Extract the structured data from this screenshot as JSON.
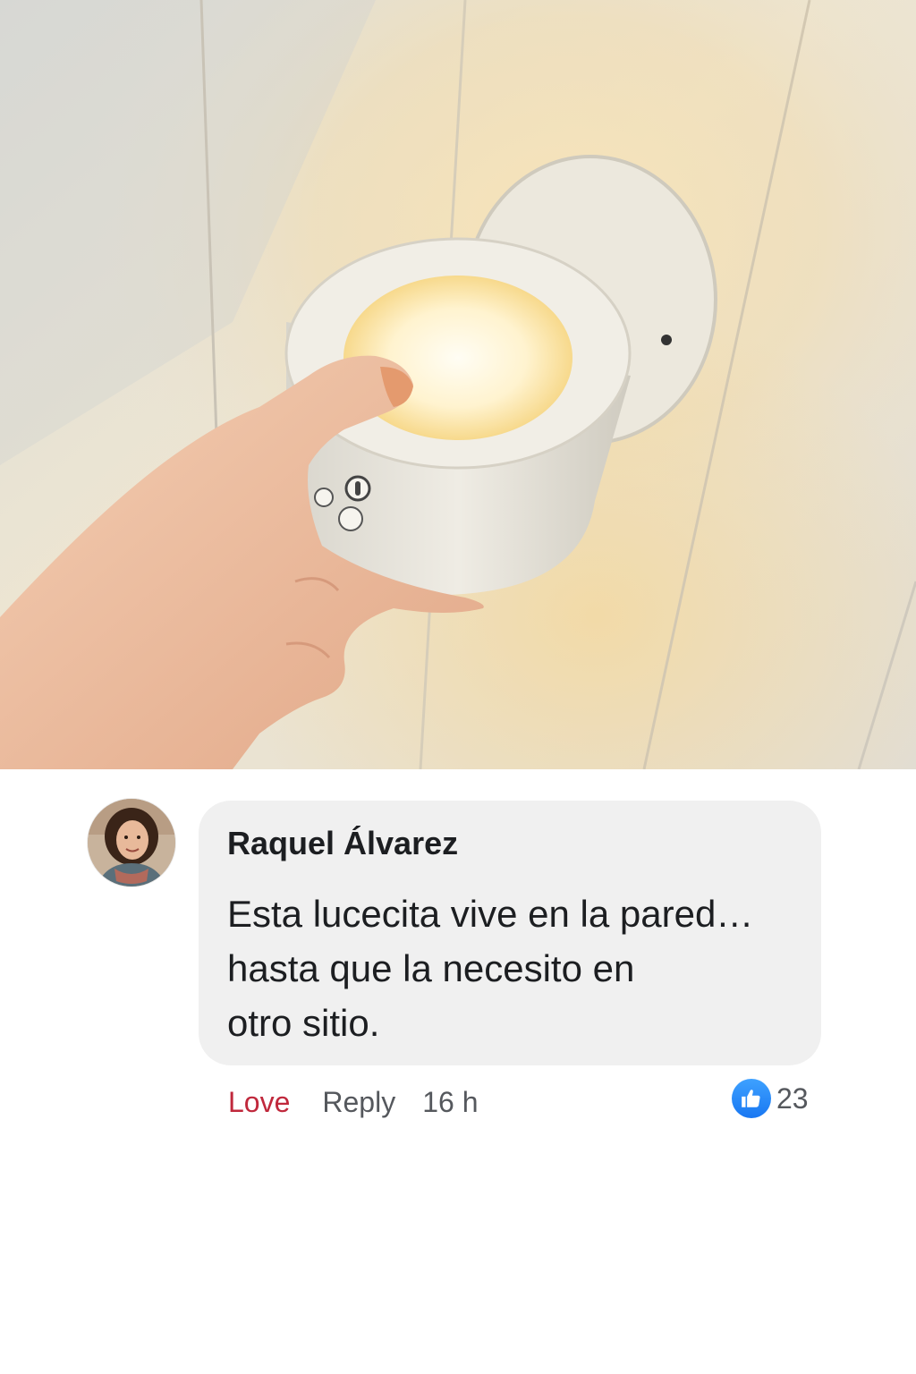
{
  "photo": {
    "description_icon": "wall-lamp-photo"
  },
  "comment": {
    "author": "Raquel Álvarez",
    "text": "Esta lucecita vive en la pared…\nhasta que la necesito en\notro sitio.",
    "actions": {
      "love_label": "Love",
      "reply_label": "Reply",
      "timestamp": "16 h"
    },
    "reactions": {
      "icon": "thumbs-up-icon",
      "count": "23"
    }
  },
  "colors": {
    "love": "#c0283c",
    "like_badge": "#1877f2",
    "bubble": "#f0f0f0",
    "secondary_text": "#55585d"
  }
}
